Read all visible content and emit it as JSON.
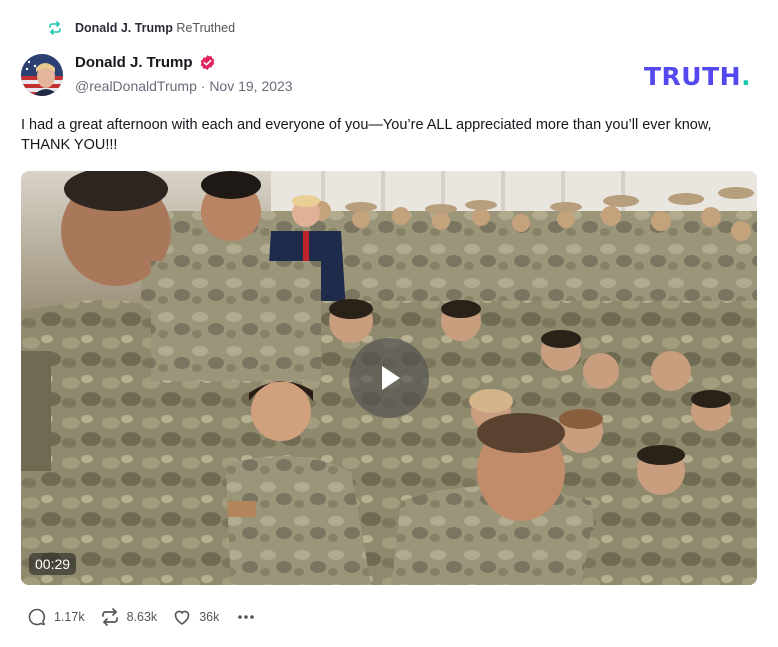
{
  "retruth": {
    "icon": "retruth-icon",
    "user_name": "Donald J. Trump",
    "action": "ReTruthed"
  },
  "author": {
    "display_name": "Donald J. Trump",
    "verified_icon": "verified-badge-icon",
    "handle": "@realDonaldTrump",
    "separator": "·",
    "date": "Nov 19, 2023",
    "avatar_icon": "avatar-photo"
  },
  "brand": {
    "logo_text": "TRUTH",
    "logo_dot": ".",
    "logo_color": "#5448ee",
    "dot_color": "#1bc7ad"
  },
  "post": {
    "text": "I had a great afternoon with each and everyone of you—You’re ALL appreciated more than you’ll ever know, THANK YOU!!!"
  },
  "media": {
    "type": "video",
    "duration": "00:29",
    "play_icon": "play-icon"
  },
  "actions": {
    "replies": {
      "icon": "reply-icon",
      "count": "1.17k"
    },
    "retruths": {
      "icon": "retruth-icon",
      "count": "8.63k"
    },
    "likes": {
      "icon": "heart-icon",
      "count": "36k"
    },
    "more_icon": "more-options-icon"
  }
}
